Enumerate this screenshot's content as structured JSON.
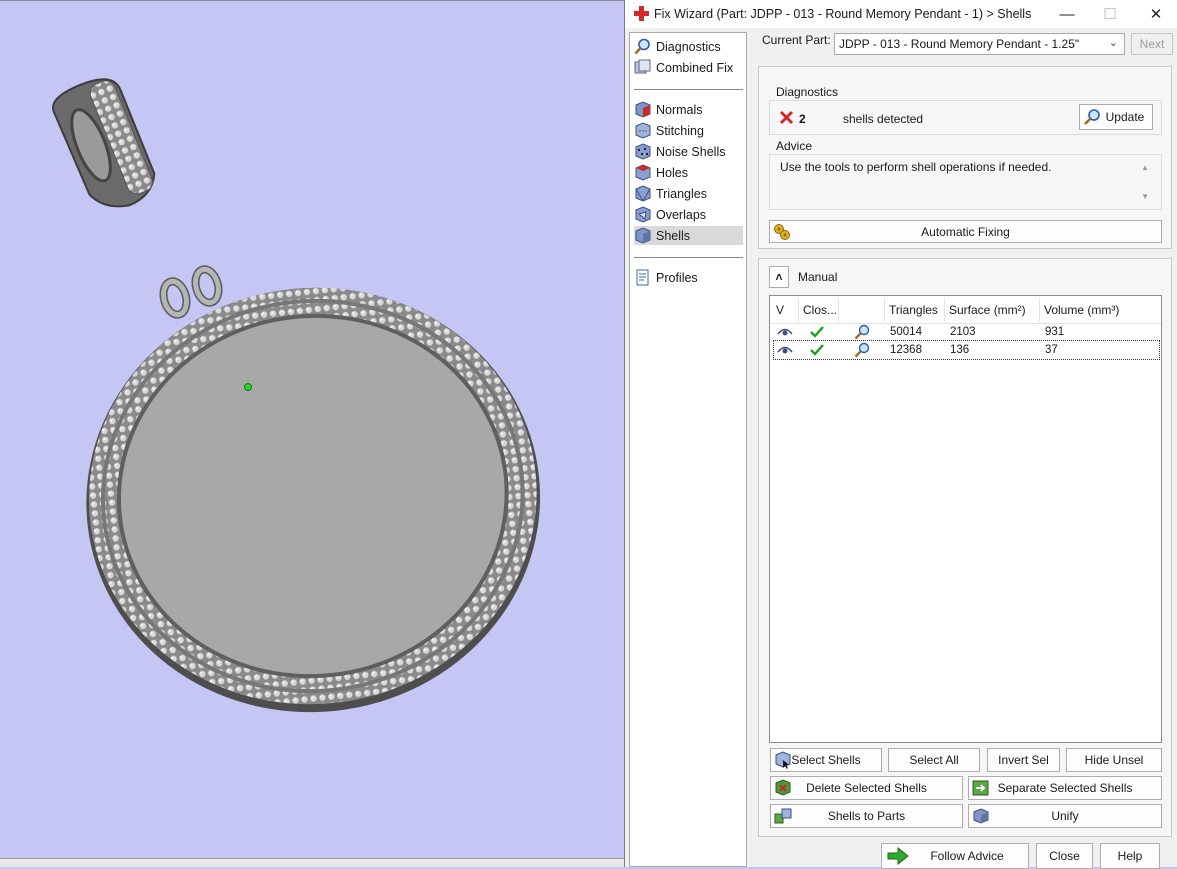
{
  "window": {
    "title": "Fix Wizard (Part: JDPP - 013 - Round Memory Pendant - 1) > Shells",
    "minimize_glyph": "—",
    "maximize_glyph": "☐",
    "close_glyph": "✕"
  },
  "nav": {
    "group1": [
      {
        "label": "Diagnostics",
        "icon": "magnifier-icon"
      },
      {
        "label": "Combined Fix",
        "icon": "combined-fix-icon"
      }
    ],
    "group2": [
      {
        "label": "Normals",
        "icon": "normals-cube-icon"
      },
      {
        "label": "Stitching",
        "icon": "stitching-cube-icon"
      },
      {
        "label": "Noise Shells",
        "icon": "noise-shells-cube-icon"
      },
      {
        "label": "Holes",
        "icon": "holes-cube-icon"
      },
      {
        "label": "Triangles",
        "icon": "triangles-cube-icon"
      },
      {
        "label": "Overlaps",
        "icon": "overlaps-cube-icon"
      },
      {
        "label": "Shells",
        "icon": "shells-cube-icon",
        "selected": true
      }
    ],
    "group3": [
      {
        "label": "Profiles",
        "icon": "profiles-document-icon"
      }
    ]
  },
  "header": {
    "current_part_label": "Current Part:",
    "current_part_value": "JDPP - 013 - Round Memory Pendant - 1.25\"",
    "next_label": "Next"
  },
  "diagnostics": {
    "title": "Diagnostics",
    "count": "2",
    "message": "shells detected",
    "update_label": "Update"
  },
  "advice": {
    "title": "Advice",
    "text": "Use the tools to perform shell operations if needed."
  },
  "automatic_fixing_label": "Automatic Fixing",
  "manual": {
    "title": "Manual",
    "columns": [
      "V",
      "Clos...",
      "",
      "Triangles",
      "Surface (mm²)",
      "Volume (mm³)"
    ],
    "rows": [
      {
        "triangles": "50014",
        "surface": "2103",
        "volume": "931",
        "closed": true,
        "selected": false
      },
      {
        "triangles": "12368",
        "surface": "136",
        "volume": "37",
        "closed": true,
        "selected": true
      }
    ]
  },
  "buttons": {
    "select_shells": "Select Shells",
    "select_all": "Select All",
    "invert_sel": "Invert Sel",
    "hide_unsel": "Hide Unsel",
    "delete_selected": "Delete Selected Shells",
    "separate_selected": "Separate Selected Shells",
    "shells_to_parts": "Shells to Parts",
    "unify": "Unify",
    "follow_advice": "Follow Advice",
    "close": "Close",
    "help": "Help"
  },
  "colors": {
    "viewport_bg": "#c6c6f5",
    "model_gray": "#a8a8a8",
    "accent_red": "#d22a2a",
    "check_green": "#1aa01a"
  }
}
